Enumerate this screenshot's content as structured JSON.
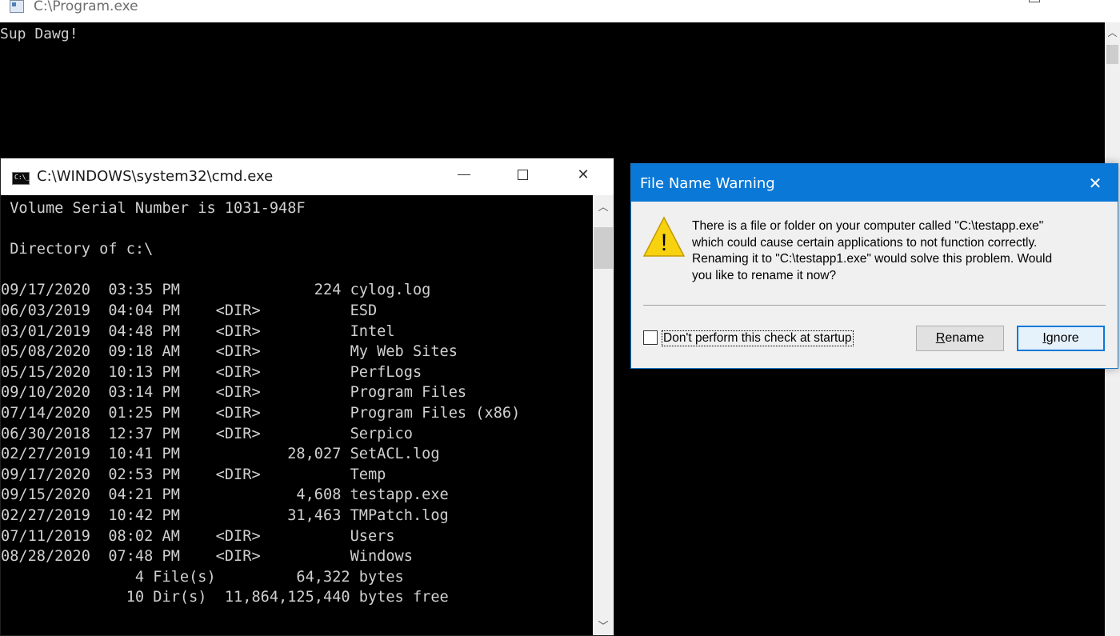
{
  "background_window": {
    "title": "C:\\Program.exe",
    "console_text": "Sup Dawg!"
  },
  "cmd_window": {
    "title": "C:\\WINDOWS\\system32\\cmd.exe",
    "lines": [
      " Volume Serial Number is 1031-948F",
      "",
      " Directory of c:\\",
      "",
      "09/17/2020  03:35 PM               224 cylog.log",
      "06/03/2019  04:04 PM    <DIR>          ESD",
      "03/01/2019  04:48 PM    <DIR>          Intel",
      "05/08/2020  09:18 AM    <DIR>          My Web Sites",
      "05/15/2020  10:13 PM    <DIR>          PerfLogs",
      "09/10/2020  03:14 PM    <DIR>          Program Files",
      "07/14/2020  01:25 PM    <DIR>          Program Files (x86)",
      "06/30/2018  12:37 PM    <DIR>          Serpico",
      "02/27/2019  10:41 PM            28,027 SetACL.log",
      "09/17/2020  02:53 PM    <DIR>          Temp",
      "09/15/2020  04:21 PM             4,608 testapp.exe",
      "02/27/2019  10:42 PM            31,463 TMPatch.log",
      "07/11/2019  08:02 AM    <DIR>          Users",
      "08/28/2020  07:48 PM    <DIR>          Windows",
      "               4 File(s)         64,322 bytes",
      "              10 Dir(s)  11,864,125,440 bytes free"
    ]
  },
  "dialog": {
    "title": "File Name Warning",
    "message_lines": [
      "There is a file or folder on your computer called \"C:\\testapp.exe\"",
      "which could cause certain applications to not function correctly.",
      "Renaming it to \"C:\\testapp1.exe\" would solve this problem.  Would",
      "you like to rename it now?"
    ],
    "checkbox_label": "Don't perform this check at startup",
    "checkbox_checked": false,
    "rename_button": {
      "first": "R",
      "rest": "ename"
    },
    "ignore_button": {
      "first": "I",
      "rest": "gnore"
    },
    "warning_symbol": "!",
    "icons": {
      "warning": "warning-icon",
      "close": "close-icon"
    },
    "colors": {
      "titlebar": "#0a78d7",
      "warning_fill": "#f7d20e"
    }
  }
}
